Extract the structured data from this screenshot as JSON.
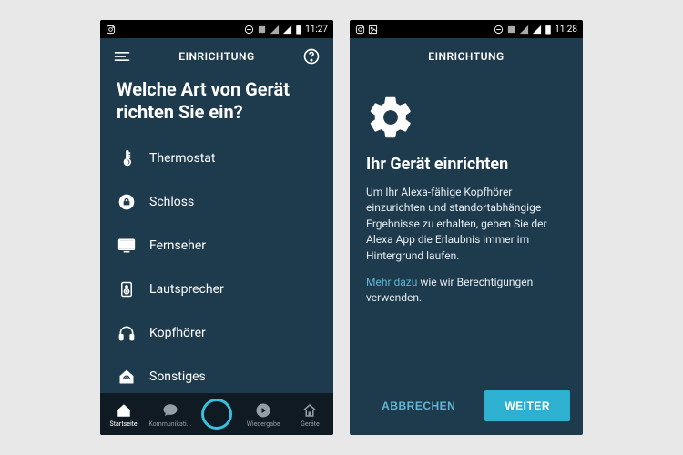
{
  "statusbar": {
    "time1": "11:27",
    "time2": "11:28"
  },
  "screen1": {
    "title": "EINRICHTUNG",
    "heading": "Welche Art von Gerät richten Sie ein?",
    "devices": [
      {
        "label": "Thermostat",
        "icon": "thermometer-icon"
      },
      {
        "label": "Schloss",
        "icon": "lock-icon"
      },
      {
        "label": "Fernseher",
        "icon": "tv-icon"
      },
      {
        "label": "Lautsprecher",
        "icon": "speaker-icon"
      },
      {
        "label": "Kopfhörer",
        "icon": "headphones-icon"
      },
      {
        "label": "Sonstiges",
        "icon": "other-icon"
      }
    ],
    "nav": [
      {
        "label": "Startseite",
        "icon": "home-icon",
        "active": true
      },
      {
        "label": "Kommunikati...",
        "icon": "chat-icon",
        "active": false
      },
      {
        "label": "",
        "icon": "alexa-icon",
        "active": false,
        "center": true
      },
      {
        "label": "Wiedergabe",
        "icon": "play-icon",
        "active": false
      },
      {
        "label": "Geräte",
        "icon": "devices-icon",
        "active": false
      }
    ]
  },
  "screen2": {
    "title": "EINRICHTUNG",
    "heading": "Ihr Gerät einrichten",
    "body1": "Um Ihr Alexa-fähige Kopfhörer einzurichten und standortabhängige Ergebnisse zu erhalten, geben Sie der Alexa App die Erlaubnis immer im Hintergrund laufen.",
    "link": "Mehr dazu",
    "body2": " wie wir Berechtigungen verwenden.",
    "cancel": "ABBRECHEN",
    "next": "WEITER"
  }
}
